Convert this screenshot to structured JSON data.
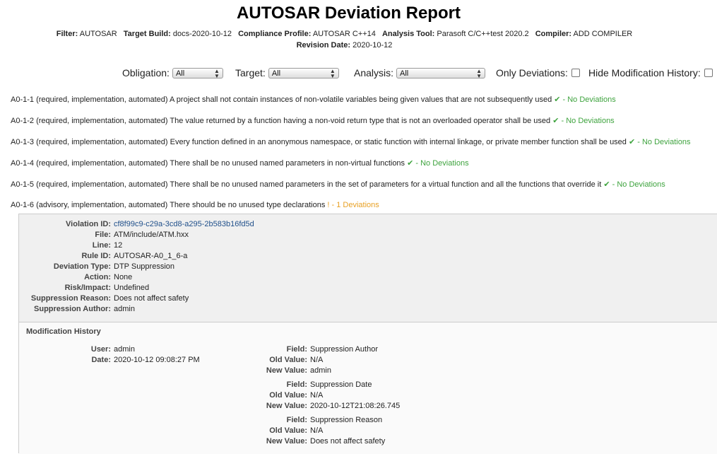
{
  "title": "AUTOSAR Deviation Report",
  "meta": {
    "filter_label": "Filter:",
    "filter": "AUTOSAR",
    "build_label": "Target Build:",
    "build": "docs-2020-10-12",
    "profile_label": "Compliance Profile:",
    "profile": "AUTOSAR C++14",
    "tool_label": "Analysis Tool:",
    "tool": "Parasoft C/C++test 2020.2",
    "compiler_label": "Compiler:",
    "compiler": "ADD COMPILER",
    "revision_label": "Revision Date:",
    "revision": "2020-10-12"
  },
  "filters": {
    "obligation_label": "Obligation:",
    "obligation": "All",
    "target_label": "Target:",
    "target": "All",
    "analysis_label": "Analysis:",
    "analysis": "All",
    "only_dev_label": "Only Deviations:",
    "hide_mod_label": "Hide Modification History:"
  },
  "rules": [
    {
      "text": "A0-1-1 (required, implementation, automated) A project shall not contain instances of non-volatile variables being given values that are not subsequently used",
      "status": "✔ - No Deviations",
      "kind": "ok"
    },
    {
      "text": "A0-1-2 (required, implementation, automated) The value returned by a function having a non-void return type that is not an overloaded operator shall be used",
      "status": "✔ - No Deviations",
      "kind": "ok"
    },
    {
      "text": "A0-1-3 (required, implementation, automated) Every function defined in an anonymous namespace, or static function with internal linkage, or private member function shall be used",
      "status": "✔ - No Deviations",
      "kind": "ok"
    },
    {
      "text": "A0-1-4 (required, implementation, automated) There shall be no unused named parameters in non-virtual functions",
      "status": "✔ - No Deviations",
      "kind": "ok"
    },
    {
      "text": "A0-1-5 (required, implementation, automated) There shall be no unused named parameters in the set of parameters for a virtual function and all the functions that override it",
      "status": "✔ - No Deviations",
      "kind": "ok"
    },
    {
      "text": "A0-1-6 (advisory, implementation, automated) There should be no unused type declarations",
      "status": "! - 1 Deviations",
      "kind": "warn"
    }
  ],
  "violation": [
    {
      "label": "Violation ID:",
      "value": "cf8f99c9-c29a-3cd8-a295-2b583b16fd5d"
    },
    {
      "label": "File:",
      "value": "ATM/include/ATM.hxx"
    },
    {
      "label": "Line:",
      "value": "12"
    },
    {
      "label": "Rule ID:",
      "value": "AUTOSAR-A0_1_6-a"
    },
    {
      "label": "Deviation Type:",
      "value": "DTP Suppression"
    },
    {
      "label": "Action:",
      "value": "None"
    },
    {
      "label": "Risk/Impact:",
      "value": "Undefined"
    },
    {
      "label": "Suppression Reason:",
      "value": "Does not affect safety"
    },
    {
      "label": "Suppression Author:",
      "value": "admin"
    }
  ],
  "history": {
    "heading": "Modification History",
    "user_label": "User:",
    "user": "admin",
    "date_label": "Date:",
    "date": "2020-10-12 09:08:27 PM",
    "changes": [
      {
        "field": "Suppression Author",
        "old": "N/A",
        "new": "admin"
      },
      {
        "field": "Suppression Date",
        "old": "N/A",
        "new": "2020-10-12T21:08:26.745"
      },
      {
        "field": "Suppression Reason",
        "old": "N/A",
        "new": "Does not affect safety"
      }
    ],
    "field_label": "Field:",
    "old_label": "Old Value:",
    "new_label": "New Value:"
  },
  "colors": {
    "ok": "#3ea33e",
    "warn": "#e8a125",
    "link": "#1f4f8a"
  }
}
